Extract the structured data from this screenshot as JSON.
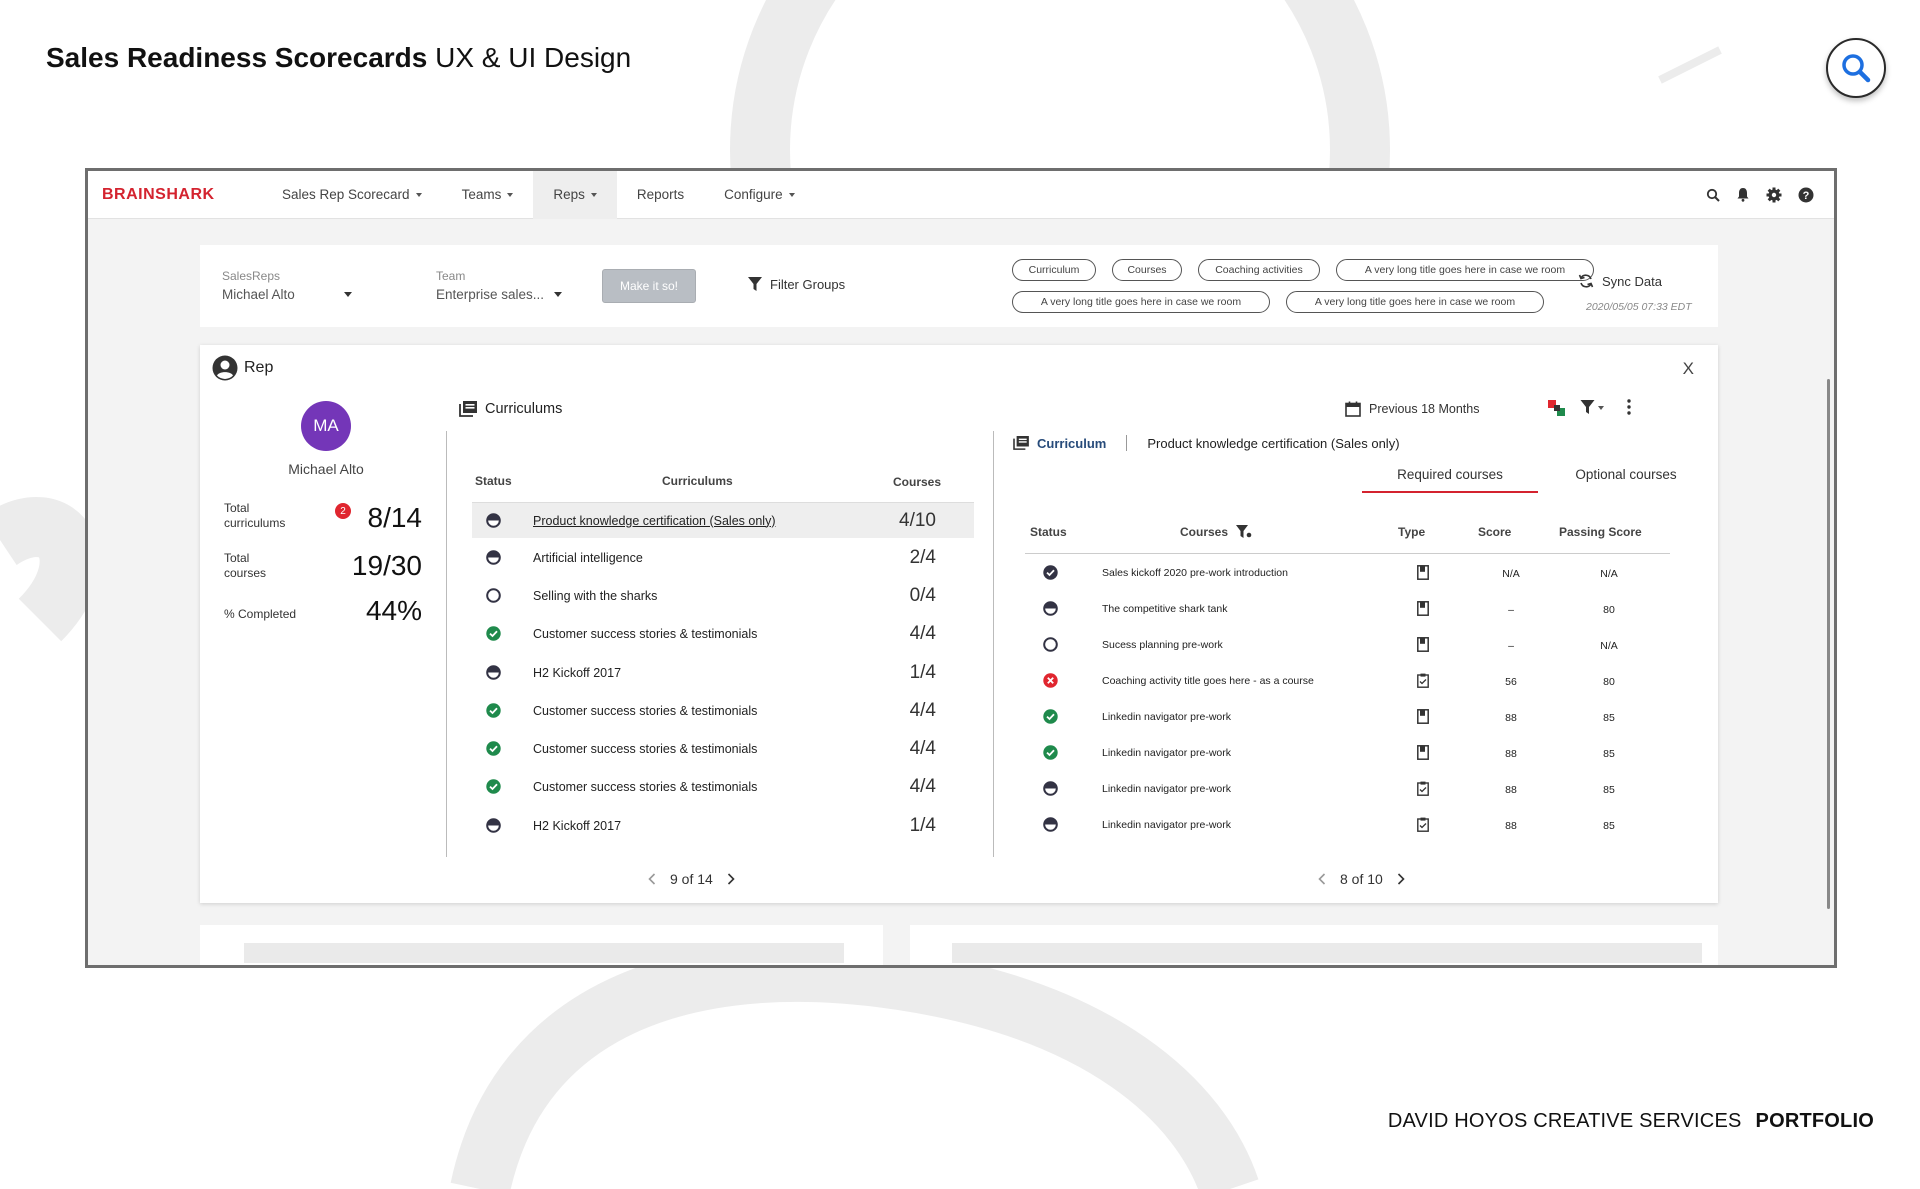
{
  "header": {
    "title_bold": "Sales Readiness Scorecards",
    "title_light": "UX & UI Design"
  },
  "footer": {
    "author": "DAVID HOYOS CREATIVE SERVICES",
    "portfolio": "PORTFOLIO"
  },
  "app": {
    "logo": "BRAINSHARK",
    "nav": [
      {
        "label": "Sales Rep Scorecard",
        "dropdown": true
      },
      {
        "label": "Teams",
        "dropdown": true
      },
      {
        "label": "Reps",
        "dropdown": true,
        "active": true
      },
      {
        "label": "Reports",
        "dropdown": false
      },
      {
        "label": "Configure",
        "dropdown": true
      }
    ],
    "nav_icons": [
      "search-icon",
      "bell-icon",
      "gear-icon",
      "help-icon"
    ]
  },
  "filters": {
    "salesreps_label": "SalesReps",
    "salesreps_value": "Michael Alto",
    "team_label": "Team",
    "team_value": "Enterprise sales...",
    "make_button": "Make it so!",
    "filter_groups": "Filter Groups",
    "chips": [
      "Curriculum",
      "Courses",
      "Coaching activities",
      "A very long title goes here in case we room",
      "A very long title goes here in case we room",
      "A very long title goes here in case we room"
    ],
    "sync_label": "Sync Data",
    "sync_date": "2020/05/05 07:33 EDT"
  },
  "rep_card": {
    "title": "Rep",
    "close": "X",
    "avatar_initials": "MA",
    "name": "Michael Alto",
    "stats": [
      {
        "label_1": "Total",
        "label_2": "curriculums",
        "value": "8/14",
        "badge": "2"
      },
      {
        "label_1": "Total",
        "label_2": "courses",
        "value": "19/30"
      },
      {
        "label_1": "% Completed",
        "label_2": "",
        "value": "44%"
      }
    ],
    "period": "Previous 18 Months",
    "accent_colors": {
      "red": "#e0262f",
      "green": "#1f8a4c",
      "navy": "#274b7a",
      "purple": "#7436b8"
    }
  },
  "curriculums": {
    "title": "Curriculums",
    "headers": {
      "status": "Status",
      "name": "Curriculums",
      "courses": "Courses"
    },
    "rows": [
      {
        "status": "half",
        "name": "Product knowledge certification (Sales only)",
        "courses": "4/10",
        "selected": true
      },
      {
        "status": "half",
        "name": "Artificial intelligence",
        "courses": "2/4"
      },
      {
        "status": "empty",
        "name": "Selling with the sharks",
        "courses": "0/4"
      },
      {
        "status": "done",
        "name": "Customer success stories & testimonials",
        "courses": "4/4"
      },
      {
        "status": "half",
        "name": "H2 Kickoff 2017",
        "courses": "1/4"
      },
      {
        "status": "done",
        "name": "Customer success stories & testimonials",
        "courses": "4/4"
      },
      {
        "status": "done",
        "name": "Customer success stories & testimonials",
        "courses": "4/4"
      },
      {
        "status": "done",
        "name": "Customer success stories & testimonials",
        "courses": "4/4"
      },
      {
        "status": "half",
        "name": "H2 Kickoff 2017",
        "courses": "1/4"
      }
    ],
    "pager": "9 of 14"
  },
  "courses": {
    "breadcrumb_label": "Curriculum",
    "breadcrumb_value": "Product knowledge certification (Sales only)",
    "tabs": [
      "Required courses",
      "Optional courses"
    ],
    "headers": {
      "status": "Status",
      "courses": "Courses",
      "type": "Type",
      "score": "Score",
      "passing": "Passing Score"
    },
    "rows": [
      {
        "status": "done-dark",
        "name": "Sales kickoff 2020 pre-work introduction",
        "type": "book",
        "score": "N/A",
        "passing": "N/A"
      },
      {
        "status": "half",
        "name": "The competitive shark tank",
        "type": "book",
        "score": "–",
        "passing": "80"
      },
      {
        "status": "empty",
        "name": "Sucess planning pre-work",
        "type": "book",
        "score": "–",
        "passing": "N/A"
      },
      {
        "status": "failed",
        "name": "Coaching activity title goes here - as a course",
        "type": "clipboard",
        "score": "56",
        "passing": "80"
      },
      {
        "status": "done",
        "name": "Linkedin navigator pre-work",
        "type": "book",
        "score": "88",
        "passing": "85"
      },
      {
        "status": "done",
        "name": "Linkedin navigator pre-work",
        "type": "book",
        "score": "88",
        "passing": "85"
      },
      {
        "status": "half",
        "name": "Linkedin navigator pre-work",
        "type": "clipboard",
        "score": "88",
        "passing": "85"
      },
      {
        "status": "half",
        "name": "Linkedin navigator pre-work",
        "type": "clipboard",
        "score": "88",
        "passing": "85"
      }
    ],
    "pager": "8 of 10"
  }
}
